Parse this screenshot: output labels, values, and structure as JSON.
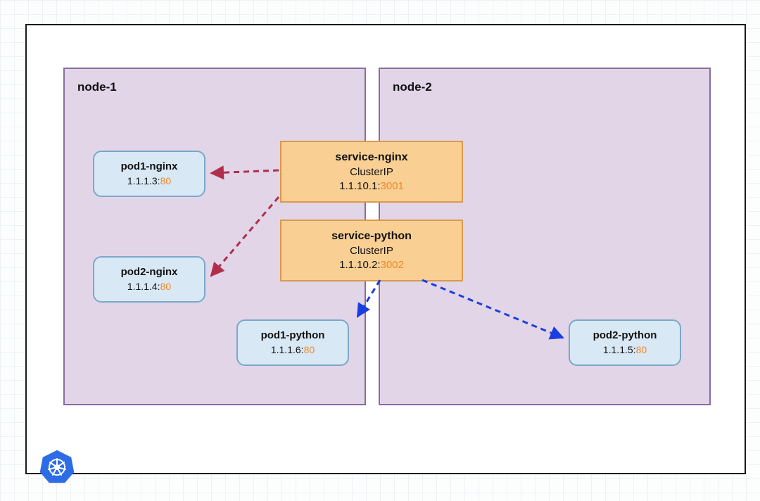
{
  "nodes": {
    "n1": {
      "title": "node-1"
    },
    "n2": {
      "title": "node-2"
    }
  },
  "pods": {
    "p1_nginx": {
      "name": "pod1-nginx",
      "ip": "1.1.1.3",
      "port": "80"
    },
    "p2_nginx": {
      "name": "pod2-nginx",
      "ip": "1.1.1.4",
      "port": "80"
    },
    "p1_python": {
      "name": "pod1-python",
      "ip": "1.1.1.6",
      "port": "80"
    },
    "p2_python": {
      "name": "pod2-python",
      "ip": "1.1.1.5",
      "port": "80"
    }
  },
  "services": {
    "nginx": {
      "name": "service-nginx",
      "type": "ClusterIP",
      "ip": "1.1.10.1",
      "port": "3001"
    },
    "python": {
      "name": "service-python",
      "type": "ClusterIP",
      "ip": "1.1.10.2",
      "port": "3002"
    }
  },
  "colors": {
    "arrow_nginx": "#B02E4C",
    "arrow_python": "#1A3FE0"
  }
}
